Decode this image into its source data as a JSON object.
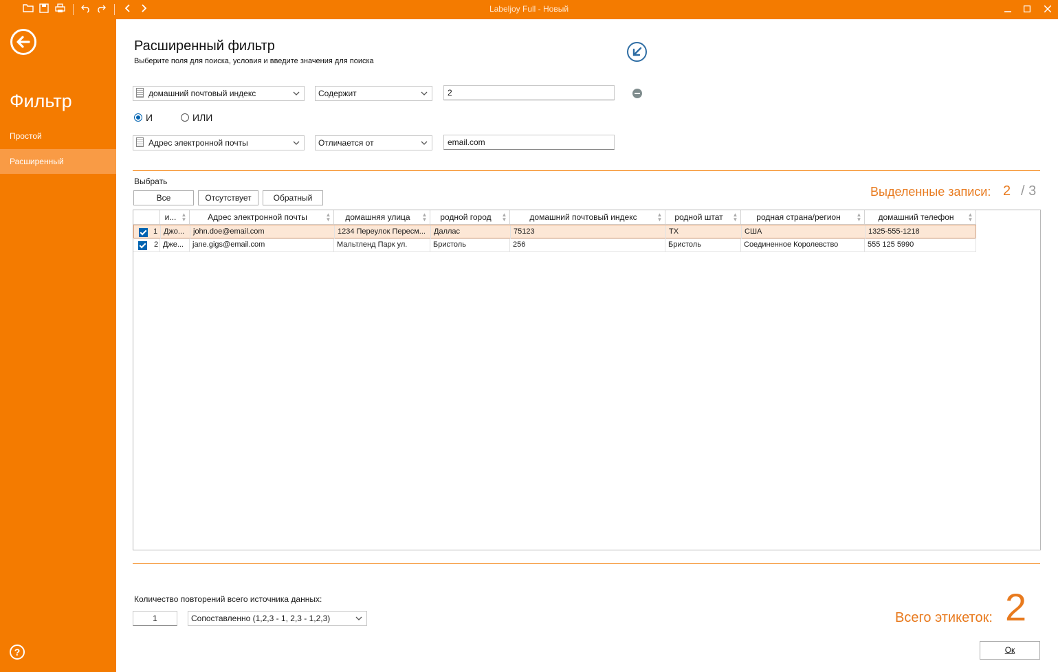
{
  "titlebar": {
    "title": "Labeljoy Full - Новый",
    "icons": [
      "open-folder-icon",
      "save-icon",
      "print-icon",
      "undo-icon",
      "redo-icon",
      "chevron-left-icon",
      "chevron-right-icon"
    ],
    "window_buttons": [
      "minimize-icon",
      "maximize-icon",
      "close-icon"
    ]
  },
  "sidebar": {
    "title": "Фильтр",
    "items": [
      {
        "label": "Простой",
        "active": false
      },
      {
        "label": "Расширенный",
        "active": true
      }
    ],
    "help": "?"
  },
  "header": {
    "title": "Расширенный фильтр",
    "subtitle": "Выберите поля для поиска, условия и введите значения для поиска"
  },
  "conditions": [
    {
      "field": "домашний почтовый индекс",
      "operator": "Содержит",
      "value": "2"
    },
    {
      "field": "Адрес электронной почты",
      "operator": "Отличается от",
      "value": "email.com"
    }
  ],
  "logic": {
    "and_label": "И",
    "or_label": "ИЛИ",
    "selected": "and"
  },
  "selection": {
    "label": "Выбрать",
    "buttons": {
      "all": "Все",
      "none": "Отсутствует",
      "invert": "Обратный"
    },
    "selected_label": "Выделенные записи:",
    "selected_count": "2",
    "total": "/ 3"
  },
  "grid": {
    "columns": [
      "и...",
      "Адрес электронной почты",
      "домашняя улица",
      "родной город",
      "домашний почтовый индекс",
      "родной штат",
      "родная страна/регион",
      "домашний телефон"
    ],
    "rows": [
      {
        "num": "1",
        "checked": true,
        "cells": [
          "Джо...",
          "john.doe@email.com",
          "1234 Переулок Пересм...",
          "Даллас",
          "75123",
          "TX",
          "США",
          "1325-555-1218"
        ]
      },
      {
        "num": "2",
        "checked": true,
        "cells": [
          "Дже...",
          "jane.gigs@email.com",
          "Мальтленд Парк ул.",
          "Бристоль",
          "256",
          "Бристоль",
          "Соединенное Королевство",
          "555 125 5990"
        ]
      }
    ]
  },
  "bottom": {
    "repeat_label": "Количество повторений всего источника данных:",
    "repeat_count": "1",
    "mode": "Сопоставленно (1,2,3 - 1, 2,3 - 1,2,3)",
    "total_label": "Всего этикеток:",
    "total_value": "2",
    "ok_label": "Ок"
  },
  "colors": {
    "accent": "#f47b00",
    "sidebar_active": "#f99b45",
    "highlight_row": "#fce7d6",
    "checkbox": "#0063b1"
  }
}
